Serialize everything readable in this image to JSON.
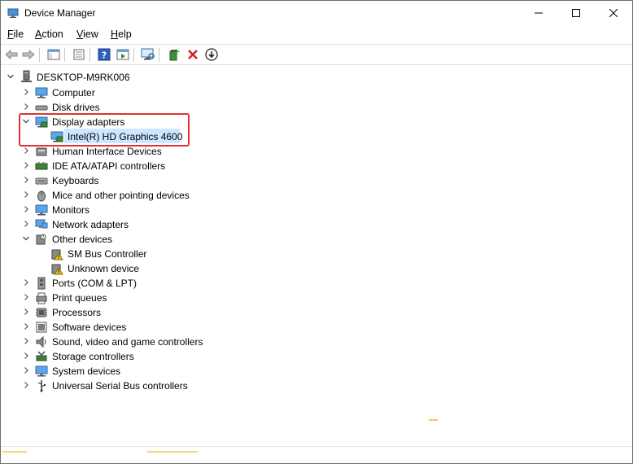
{
  "window": {
    "title": "Device Manager"
  },
  "titlebar_buttons": {
    "minimize": "—",
    "maximize": "☐",
    "close": "✕"
  },
  "menu": [
    {
      "label": "File",
      "accel": "F"
    },
    {
      "label": "Action",
      "accel": "A"
    },
    {
      "label": "View",
      "accel": "V"
    },
    {
      "label": "Help",
      "accel": "H"
    }
  ],
  "toolbar": [
    "back-icon",
    "forward-icon",
    "show-hide-console-tree-icon",
    "properties-icon",
    "help-icon",
    "run-icon",
    "scan-hardware-icon",
    "update-driver-icon",
    "uninstall-icon",
    "disable-download-icon"
  ],
  "tree": {
    "root": "DESKTOP-M9RK006",
    "items": [
      {
        "label": "Computer",
        "expanded": false
      },
      {
        "label": "Disk drives",
        "expanded": false
      },
      {
        "label": "Display adapters",
        "expanded": true
      },
      {
        "label": "Intel(R) HD Graphics 4600",
        "child": true,
        "selected": true
      },
      {
        "label": "Human Interface Devices",
        "expanded": false
      },
      {
        "label": "IDE ATA/ATAPI controllers",
        "expanded": false
      },
      {
        "label": "Keyboards",
        "expanded": false
      },
      {
        "label": "Mice and other pointing devices",
        "expanded": false
      },
      {
        "label": "Monitors",
        "expanded": false
      },
      {
        "label": "Network adapters",
        "expanded": false
      },
      {
        "label": "Other devices",
        "expanded": true
      },
      {
        "label": "SM Bus Controller",
        "child": true,
        "warning": true
      },
      {
        "label": "Unknown device",
        "child": true,
        "warning": true
      },
      {
        "label": "Ports (COM & LPT)",
        "expanded": false
      },
      {
        "label": "Print queues",
        "expanded": false
      },
      {
        "label": "Processors",
        "expanded": false
      },
      {
        "label": "Software devices",
        "expanded": false
      },
      {
        "label": "Sound, video and game controllers",
        "expanded": false
      },
      {
        "label": "Storage controllers",
        "expanded": false
      },
      {
        "label": "System devices",
        "expanded": false
      },
      {
        "label": "Universal Serial Bus controllers",
        "expanded": false
      }
    ]
  },
  "colors": {
    "highlight_border": "#e0322f",
    "selection": "#cce8ff"
  }
}
